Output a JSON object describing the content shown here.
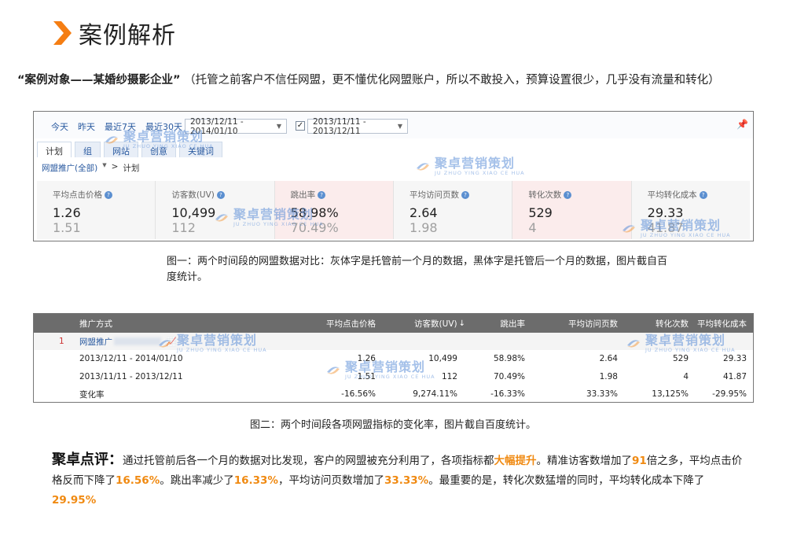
{
  "section": {
    "title": "案例解析",
    "icon": "chevron-right-icon",
    "accent_color": "#f57e13"
  },
  "case_line": {
    "subject": "“案例对象——某婚纱摄影企业”",
    "note": "（托管之前客户不信任网盟，更不懂优化网盟账户，所以不敢投入，预算设置很少，几乎没有流量和转化）"
  },
  "screenshot1": {
    "quick_links": [
      "今天",
      "昨天",
      "最近7天",
      "最近30天"
    ],
    "range_primary": "2013/12/11 - 2014/01/10",
    "compare_checked": "✓",
    "range_compare": "2013/11/11 - 2013/12/11",
    "tabs": [
      "计划",
      "组",
      "网站",
      "创意",
      "关键词"
    ],
    "breadcrumb": {
      "root": "网盟推广(全部)",
      "sep": "> ",
      "current": "计划"
    },
    "metrics": [
      {
        "label": "平均点击价格",
        "after": "1.26",
        "before": "1.51",
        "highlight": false
      },
      {
        "label": "访客数(UV)",
        "after": "10,499",
        "before": "112",
        "highlight": false
      },
      {
        "label": "跳出率",
        "after": "58.98%",
        "before": "70.49%",
        "highlight": true
      },
      {
        "label": "平均访问页数",
        "after": "2.64",
        "before": "1.98",
        "highlight": false
      },
      {
        "label": "转化次数",
        "after": "529",
        "before": "4",
        "highlight": true
      },
      {
        "label": "平均转化成本",
        "after": "29.33",
        "before": "41.87",
        "highlight": false
      }
    ]
  },
  "watermark": {
    "text": "聚卓营销策划",
    "sub": "JU ZHUO YING XIAO CE HUA"
  },
  "caption1": "图一：两个时间段的网盟数据对比：灰体字是托管前一个月的数据，黑体字是托管后一个月的数据，图片截自百度统计。",
  "screenshot2": {
    "headers": [
      "推广方式",
      "平均点击价格",
      "访客数(UV)",
      "跳出率",
      "平均访问页数",
      "转化次数",
      "平均转化成本"
    ],
    "sort_arrow": "↓",
    "row_index": "1",
    "row_name": "网盟推广",
    "rows": [
      {
        "label": "2013/12/11 - 2014/01/10",
        "values": [
          "1.26",
          "10,499",
          "58.98%",
          "2.64",
          "529",
          "29.33"
        ]
      },
      {
        "label": "2013/11/11 - 2013/12/11",
        "values": [
          "1.51",
          "112",
          "70.49%",
          "1.98",
          "4",
          "41.87"
        ]
      },
      {
        "label": "变化率",
        "values": [
          "-16.56%",
          "9,274.11%",
          "-16.33%",
          "33.33%",
          "13,125%",
          "-29.95%"
        ]
      }
    ]
  },
  "caption2": "图二：两个时间段各项网盟指标的变化率，图片截自百度统计。",
  "comment": {
    "title": "聚卓点评：",
    "p1": "通过托管前后各一个月的数据对比发现，客户的网盟被充分利用了，各项指标都",
    "h1": "大幅提升",
    "p2": "。精准访客数增加了",
    "h2": "91",
    "p3": "倍之多，平均点击价格反而下降了",
    "h3": "16.56%",
    "p4": "。跳出率减少了",
    "h4": "16.33%",
    "p5": "，平均访问页数增加了",
    "h5": "33.33%",
    "p6": "。最重要的是，转化次数猛增的同时，平均转化成本下降了",
    "h6": "29.95%",
    "highlight_color": "#f08a12"
  }
}
